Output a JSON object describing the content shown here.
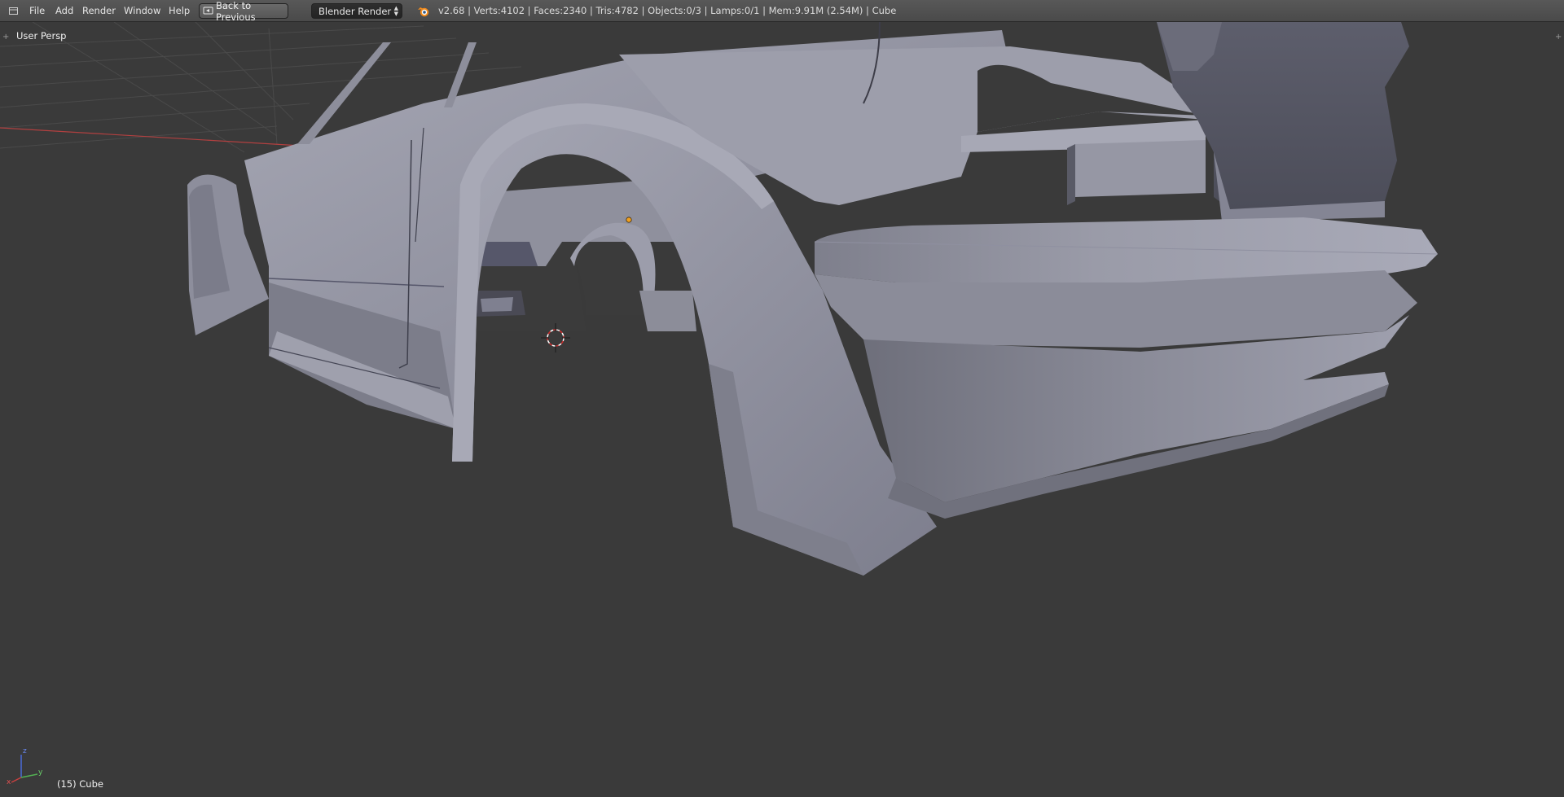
{
  "menu": {
    "editor_type_icon": "editor-type-icon",
    "items": [
      "File",
      "Add",
      "Render",
      "Window",
      "Help"
    ],
    "back_button": "Back to Previous",
    "back_button_icon": "screen-back-icon"
  },
  "render_engine": {
    "selected": "Blender Render"
  },
  "stats": {
    "logo_icon": "blender-logo-icon",
    "text": "v2.68 | Verts:4102 | Faces:2340 | Tris:4782 | Objects:0/3 | Lamps:0/1 | Mem:9.91M (2.54M) | Cube"
  },
  "viewport": {
    "view_label": "User Persp",
    "object_info": "(15) Cube",
    "axis_labels": {
      "x": "x",
      "y": "y",
      "z": "z"
    },
    "colors": {
      "background": "#3a3a3a",
      "mesh": "#8e8f9e",
      "grid_red": "#c84040",
      "grid_green": "#58c058",
      "cursor": "#d03030",
      "origin": "#f0a020"
    }
  }
}
